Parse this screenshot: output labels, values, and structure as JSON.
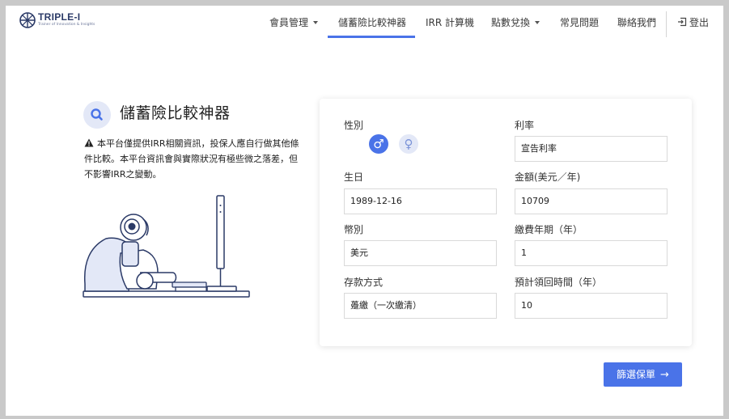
{
  "brand": {
    "name": "TRIPLE-I",
    "tagline": "Trainer of Innovation & Insights"
  },
  "nav": {
    "items": [
      {
        "label": "會員管理",
        "dropdown": true
      },
      {
        "label": "儲蓄險比較神器",
        "dropdown": false,
        "active": true
      },
      {
        "label": "IRR 計算機",
        "dropdown": false
      },
      {
        "label": "點數兌換",
        "dropdown": true
      },
      {
        "label": "常見問題",
        "dropdown": false
      },
      {
        "label": "聯絡我們",
        "dropdown": false
      }
    ],
    "logout": "登出"
  },
  "page": {
    "title": "儲蓄險比較神器",
    "notice": "本平台僅提供IRR相關資訊，投保人應自行做其他條件比較。本平台資訊會與實際狀況有極些微之落差，但不影響IRR之變動。"
  },
  "form": {
    "gender": {
      "label": "性別",
      "selected": "male",
      "options": [
        "♂",
        "♀"
      ]
    },
    "rate": {
      "label": "利率",
      "value": "宣告利率"
    },
    "birthday": {
      "label": "生日",
      "value": "1989-12-16"
    },
    "amount": {
      "label": "金額(美元／年)",
      "value": "10709"
    },
    "currency": {
      "label": "幣別",
      "value": "美元"
    },
    "pay_years": {
      "label": "繳費年期（年）",
      "value": "1"
    },
    "deposit_method": {
      "label": "存款方式",
      "value": "躉繳（一次繳清）"
    },
    "payout_time": {
      "label": "預計領回時間（年）",
      "value": "10"
    }
  },
  "actions": {
    "filter_label": "篩選保單",
    "filter_arrow": "→"
  },
  "colors": {
    "accent": "#4a73e8",
    "accent_light": "#e3e8f7",
    "brand": "#2b3a67"
  },
  "icons": {
    "search": "search-icon",
    "warning": "warning-icon",
    "logout": "logout-icon",
    "arrow": "arrow-right-icon"
  }
}
